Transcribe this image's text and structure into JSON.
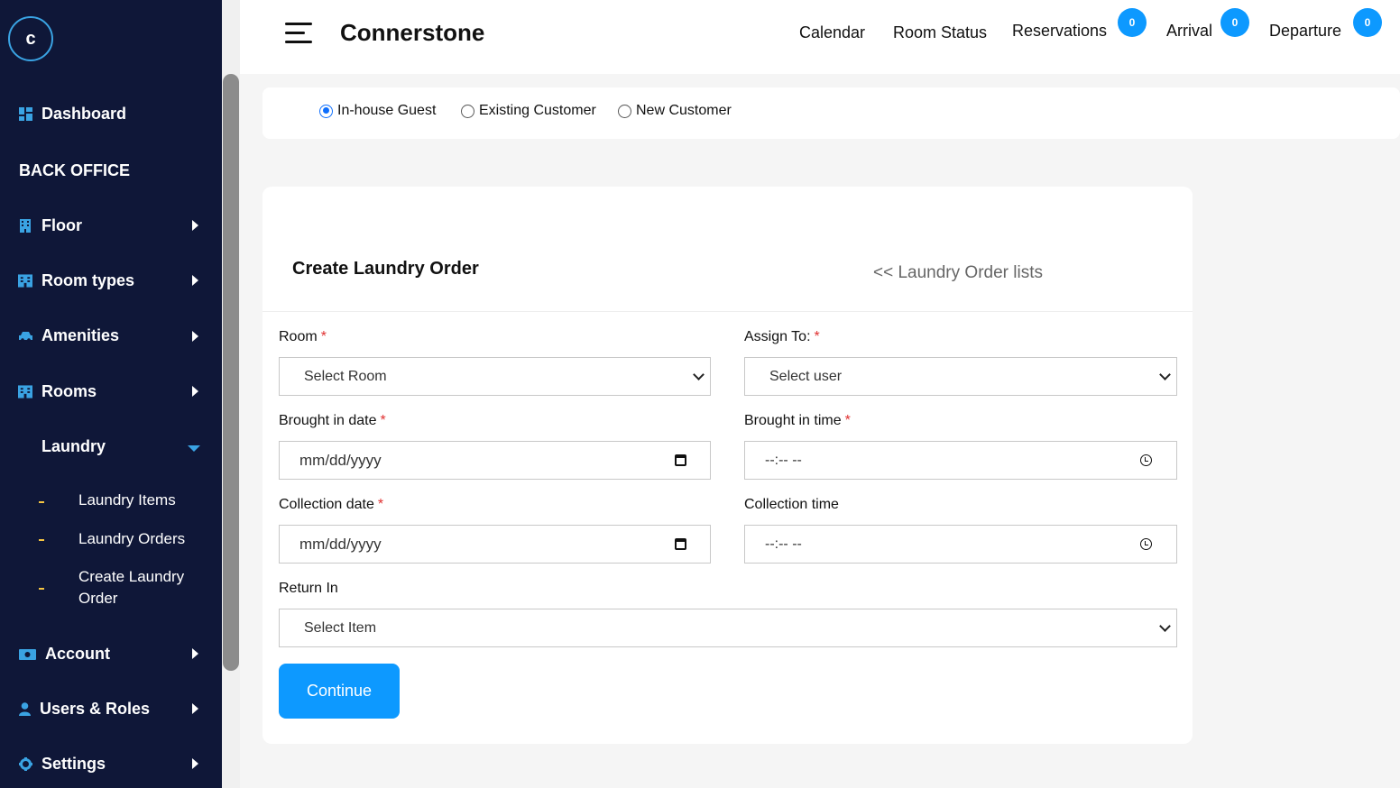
{
  "sidebar": {
    "logo_letter": "c",
    "items": [
      {
        "label": "Dashboard",
        "icon": "grid-icon"
      },
      {
        "label": "BACK OFFICE"
      },
      {
        "label": "Floor",
        "icon": "building-icon"
      },
      {
        "label": "Room types",
        "icon": "hotel-icon"
      },
      {
        "label": "Amenities",
        "icon": "car-icon"
      },
      {
        "label": "Rooms",
        "icon": "hotel-icon"
      },
      {
        "label": "Laundry"
      },
      {
        "label": "Account",
        "icon": "money-icon"
      },
      {
        "label": "Users & Roles",
        "icon": "user-icon"
      },
      {
        "label": "Settings",
        "icon": "gear-icon"
      }
    ],
    "laundry_sub": [
      "Laundry Items",
      "Laundry Orders",
      "Create Laundry Order"
    ]
  },
  "header": {
    "brand": "Connerstone",
    "nav": [
      {
        "label": "Calendar"
      },
      {
        "label": "Room Status"
      },
      {
        "label": "Reservations",
        "badge": "0"
      },
      {
        "label": "Arrival",
        "badge": "0"
      },
      {
        "label": "Departure",
        "badge": "0"
      }
    ]
  },
  "customer_type": {
    "options": [
      "In-house Guest",
      "Existing Customer",
      "New Customer"
    ],
    "selected": "In-house Guest"
  },
  "form": {
    "title": "Create Laundry Order",
    "back_link": "<< Laundry Order lists",
    "room_label": "Room",
    "room_value": "Select Room",
    "assign_label": "Assign To:",
    "assign_value": "Select user",
    "brought_date_label": "Brought in date",
    "brought_date_placeholder": "mm/dd/yyyy",
    "brought_time_label": "Brought in time",
    "brought_time_placeholder": "--:-- --",
    "collection_date_label": "Collection date",
    "collection_date_placeholder": "mm/dd/yyyy",
    "collection_time_label": "Collection time",
    "collection_time_placeholder": "--:-- --",
    "return_label": "Return In",
    "return_value": "Select Item",
    "required_mark": "*",
    "submit_label": "Continue"
  },
  "colors": {
    "sidebar_bg": "#0f1738",
    "accent": "#0d99ff",
    "icon_blue": "#3aa3e3",
    "required": "#e03131"
  }
}
